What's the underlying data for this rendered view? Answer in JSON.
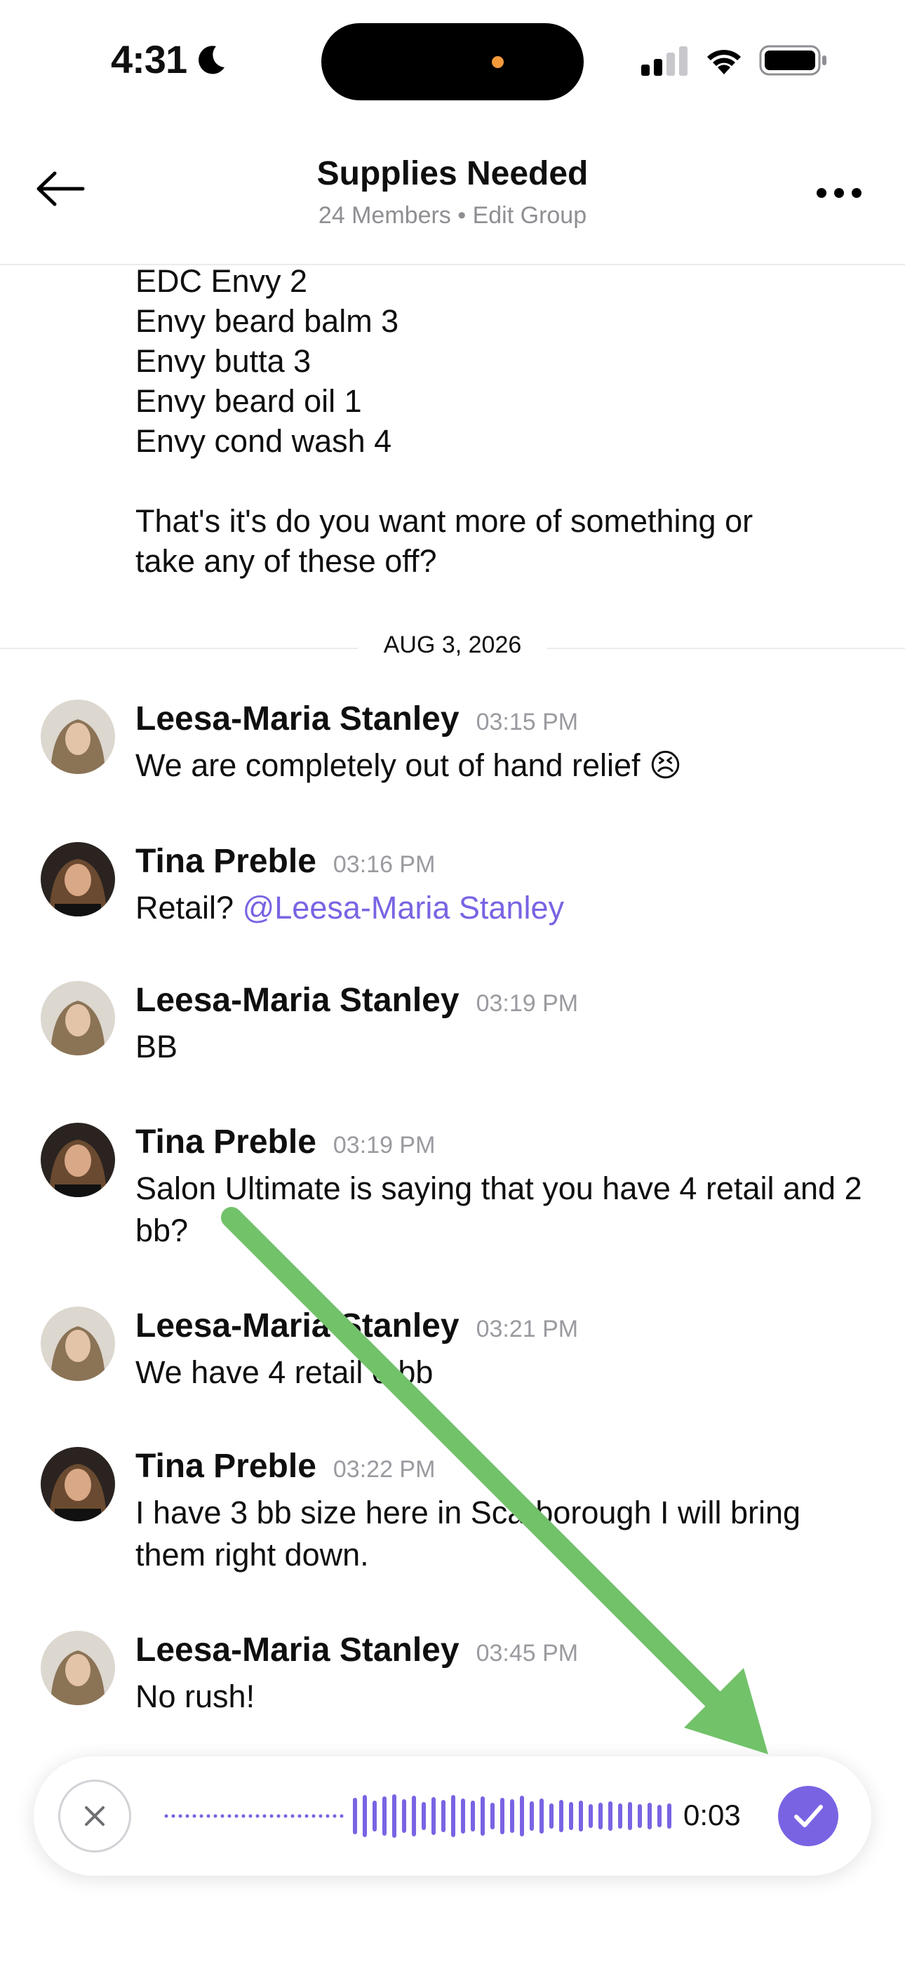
{
  "status_bar": {
    "time": "4:31"
  },
  "header": {
    "title": "Supplies Needed",
    "subtitle": "24 Members • Edit Group"
  },
  "previous_message_lines": [
    "EDC Envy 2",
    "Envy beard balm 3",
    "Envy butta 3",
    "Envy beard oil 1",
    "Envy cond wash 4",
    "",
    "That's it's do you want more of something or",
    "take any of these off?"
  ],
  "date_divider": "AUG 3, 2026",
  "messages": [
    {
      "name": "Leesa-Maria Stanley",
      "time": "03:15 PM",
      "text": "We are completely out of hand relief 😣",
      "mention": ""
    },
    {
      "name": "Tina Preble",
      "time": "03:16 PM",
      "text": "Retail? ",
      "mention": "@Leesa-Maria Stanley"
    },
    {
      "name": "Leesa-Maria Stanley",
      "time": "03:19 PM",
      "text": "BB",
      "mention": ""
    },
    {
      "name": "Tina Preble",
      "time": "03:19 PM",
      "text": "Salon Ultimate is saying that you have 4 retail and 2 bb?",
      "mention": ""
    },
    {
      "name": "Leesa-Maria Stanley",
      "time": "03:21 PM",
      "text": "We have 4 retail 0 bb",
      "mention": ""
    },
    {
      "name": "Tina Preble",
      "time": "03:22 PM",
      "text": "I have 3 bb size here in Scarborough I will bring them right down.",
      "mention": ""
    },
    {
      "name": "Leesa-Maria Stanley",
      "time": "03:45 PM",
      "text": "No rush!",
      "mention": ""
    }
  ],
  "recorder": {
    "duration": "0:03"
  },
  "colors": {
    "accent": "#7a63e3",
    "annotation_arrow": "#72c26a"
  }
}
